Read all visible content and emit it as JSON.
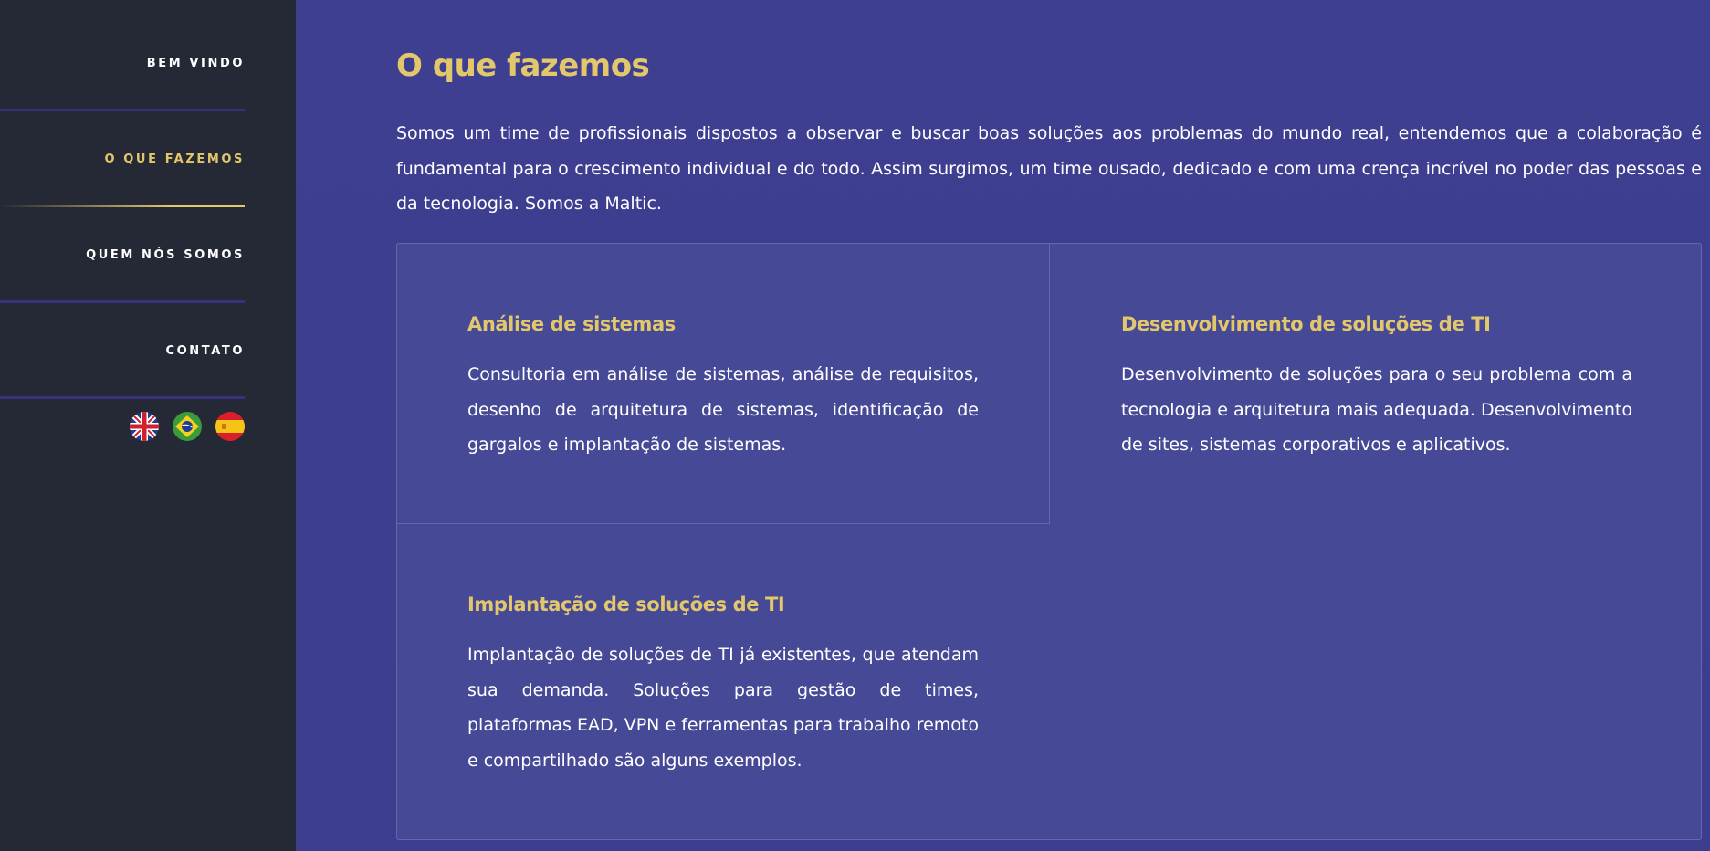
{
  "nav": {
    "items": [
      {
        "label": "BEM VINDO"
      },
      {
        "label": "O QUE FAZEMOS"
      },
      {
        "label": "QUEM NÓS SOMOS"
      },
      {
        "label": "CONTATO"
      }
    ],
    "active_index": 1,
    "languages": [
      "uk-flag-icon",
      "brazil-flag-icon",
      "spain-flag-icon"
    ]
  },
  "main": {
    "title": "O que fazemos",
    "intro": "Somos um time de profissionais dispostos a observar e buscar boas soluções aos problemas do mundo real, entendemos que a colaboração é fundamental para o crescimento individual e do todo. Assim surgimos, um time ousado, dedicado e com uma crença incrível no poder das pessoas e da tecnologia. Somos a Maltic.",
    "services": [
      {
        "title": "Análise de sistemas",
        "description": "Consultoria em análise de sistemas, análise de requisitos, desenho de arquitetura de sistemas, identificação de gargalos e implantação de sistemas."
      },
      {
        "title": "Desenvolvimento de soluções de TI",
        "description": "Desenvolvimento de soluções para o seu problema com a tecnologia e arquitetura mais adequada. Desenvolvimento de sites, sistemas corporativos e aplicativos."
      },
      {
        "title": "Implantação de soluções de TI",
        "description": "Implantação de soluções de TI já existentes, que atendam sua demanda. Soluções para gestão de times, plataformas EAD, VPN e ferramentas para trabalho remoto e compartilhado são alguns exemplos."
      }
    ]
  },
  "colors": {
    "sidebar_bg": "#252936",
    "main_bg": "#3e3f91",
    "card_bg": "#464a96",
    "accent": "#e3c76b",
    "text": "#ffffff"
  }
}
